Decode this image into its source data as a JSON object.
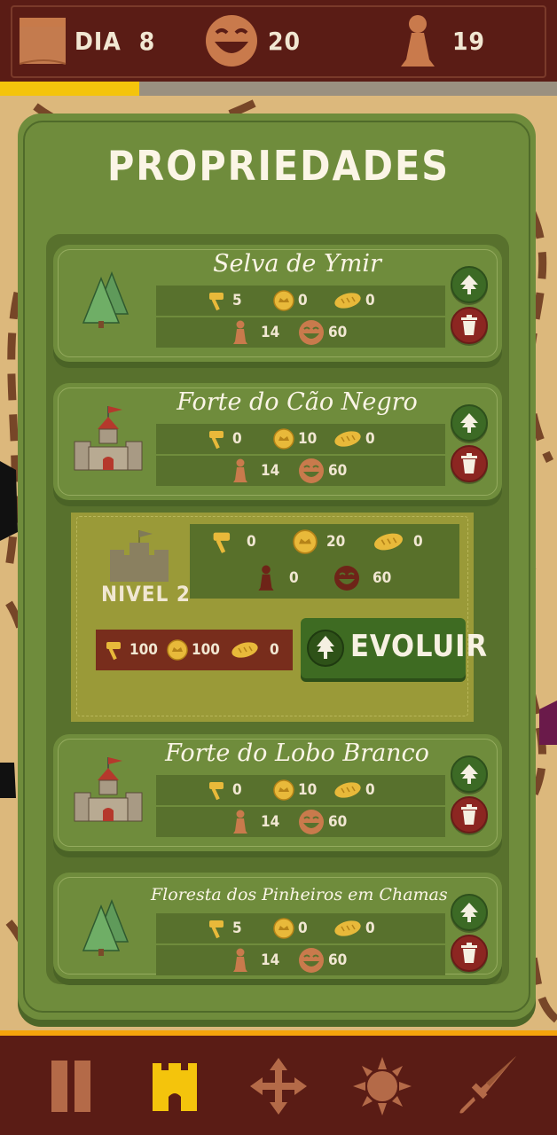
{
  "hud": {
    "day_label": "DIA",
    "day": "8",
    "happiness": "20",
    "population": "19",
    "day_progress": 0.25
  },
  "panel": {
    "title": "PROPRIEDADES"
  },
  "properties": [
    {
      "name": "Selva de Ymir",
      "icon": "forest-icon",
      "wood": "5",
      "gold": "0",
      "food": "0",
      "population": "14",
      "happiness": "60"
    },
    {
      "name": "Forte do Cão Negro",
      "icon": "castle-icon",
      "wood": "0",
      "gold": "10",
      "food": "0",
      "population": "14",
      "happiness": "60"
    },
    {
      "name": "Forte do Lobo Branco",
      "icon": "castle-icon",
      "wood": "0",
      "gold": "10",
      "food": "0",
      "population": "14",
      "happiness": "60"
    },
    {
      "name": "Floresta dos Pinheiros em Chamas",
      "icon": "forest-icon",
      "wood": "5",
      "gold": "0",
      "food": "0",
      "population": "14",
      "happiness": "60"
    }
  ],
  "upgrade": {
    "level_label": "NIVEL 2",
    "wood": "0",
    "gold": "20",
    "food": "0",
    "population": "0",
    "happiness": "60",
    "cost_wood": "100",
    "cost_gold": "100",
    "cost_food": "0",
    "evolve_label": "EVOLUIR"
  },
  "nav": [
    "pause-icon",
    "castle-tab-icon",
    "move-icon",
    "sun-icon",
    "sword-icon"
  ],
  "colors": {
    "panel": "#6f8c3c",
    "bar": "#5a1c15",
    "accent": "#f4c40c",
    "upgrade_button": "#3c6a25",
    "delete_button": "#8c2621"
  }
}
